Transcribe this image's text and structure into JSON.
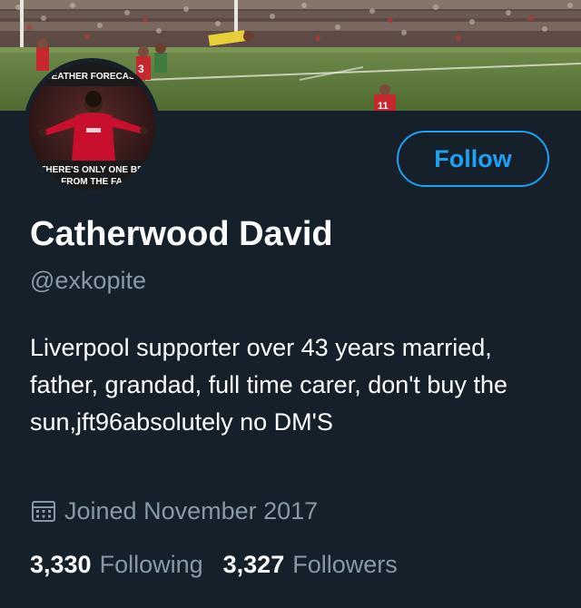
{
  "profile": {
    "display_name": "Catherwood David",
    "handle": "@exkopite",
    "bio": "Liverpool supporter over 43 years married, father, grandad, full time carer, don't buy the sun,jft96absolutely no DM'S",
    "joined": "Joined November 2017",
    "follow_label": "Follow"
  },
  "stats": {
    "following_count": "3,330",
    "following_label": "Following",
    "followers_count": "3,327",
    "followers_label": "Followers"
  },
  "avatar": {
    "caption_top": "WEATHER FORECAST",
    "caption_bottom_1": "THERE'S ONLY ONE BE",
    "caption_bottom_2": "FROM THE FA"
  },
  "banner": {
    "player_number_a": "3",
    "player_number_b": "11"
  },
  "colors": {
    "background": "#15202b",
    "accent": "#1da1f2",
    "secondary_text": "#8899a6",
    "primary_text": "#ffffff"
  },
  "icons": {
    "joined": "calendar-icon"
  }
}
